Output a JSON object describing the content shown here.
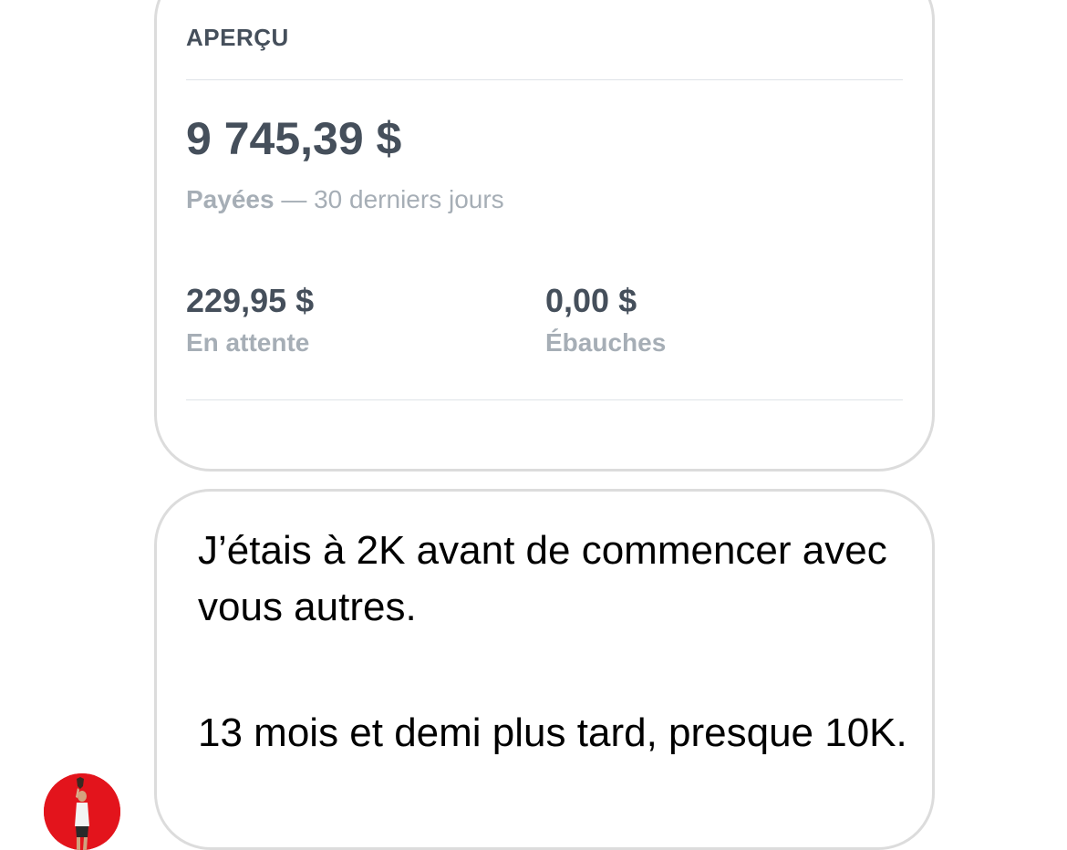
{
  "overview_card": {
    "title": "APERÇU",
    "paid_amount": "9 745,39 $",
    "paid_label": "Payées",
    "paid_period": " — 30 derniers jours",
    "pending_amount": "229,95 $",
    "pending_label": "En attente",
    "drafts_amount": "0,00 $",
    "drafts_label": "Ébauches"
  },
  "message": {
    "line_1": "J’étais à 2K avant de commencer avec vous autres.",
    "line_2": "13 mois et demi plus tard, presque 10K."
  },
  "colors": {
    "avatar_background": "#e3141c",
    "bubble_border": "#dcdcdc",
    "amount_text": "#454f5b",
    "muted_text": "#a6aeb6"
  }
}
